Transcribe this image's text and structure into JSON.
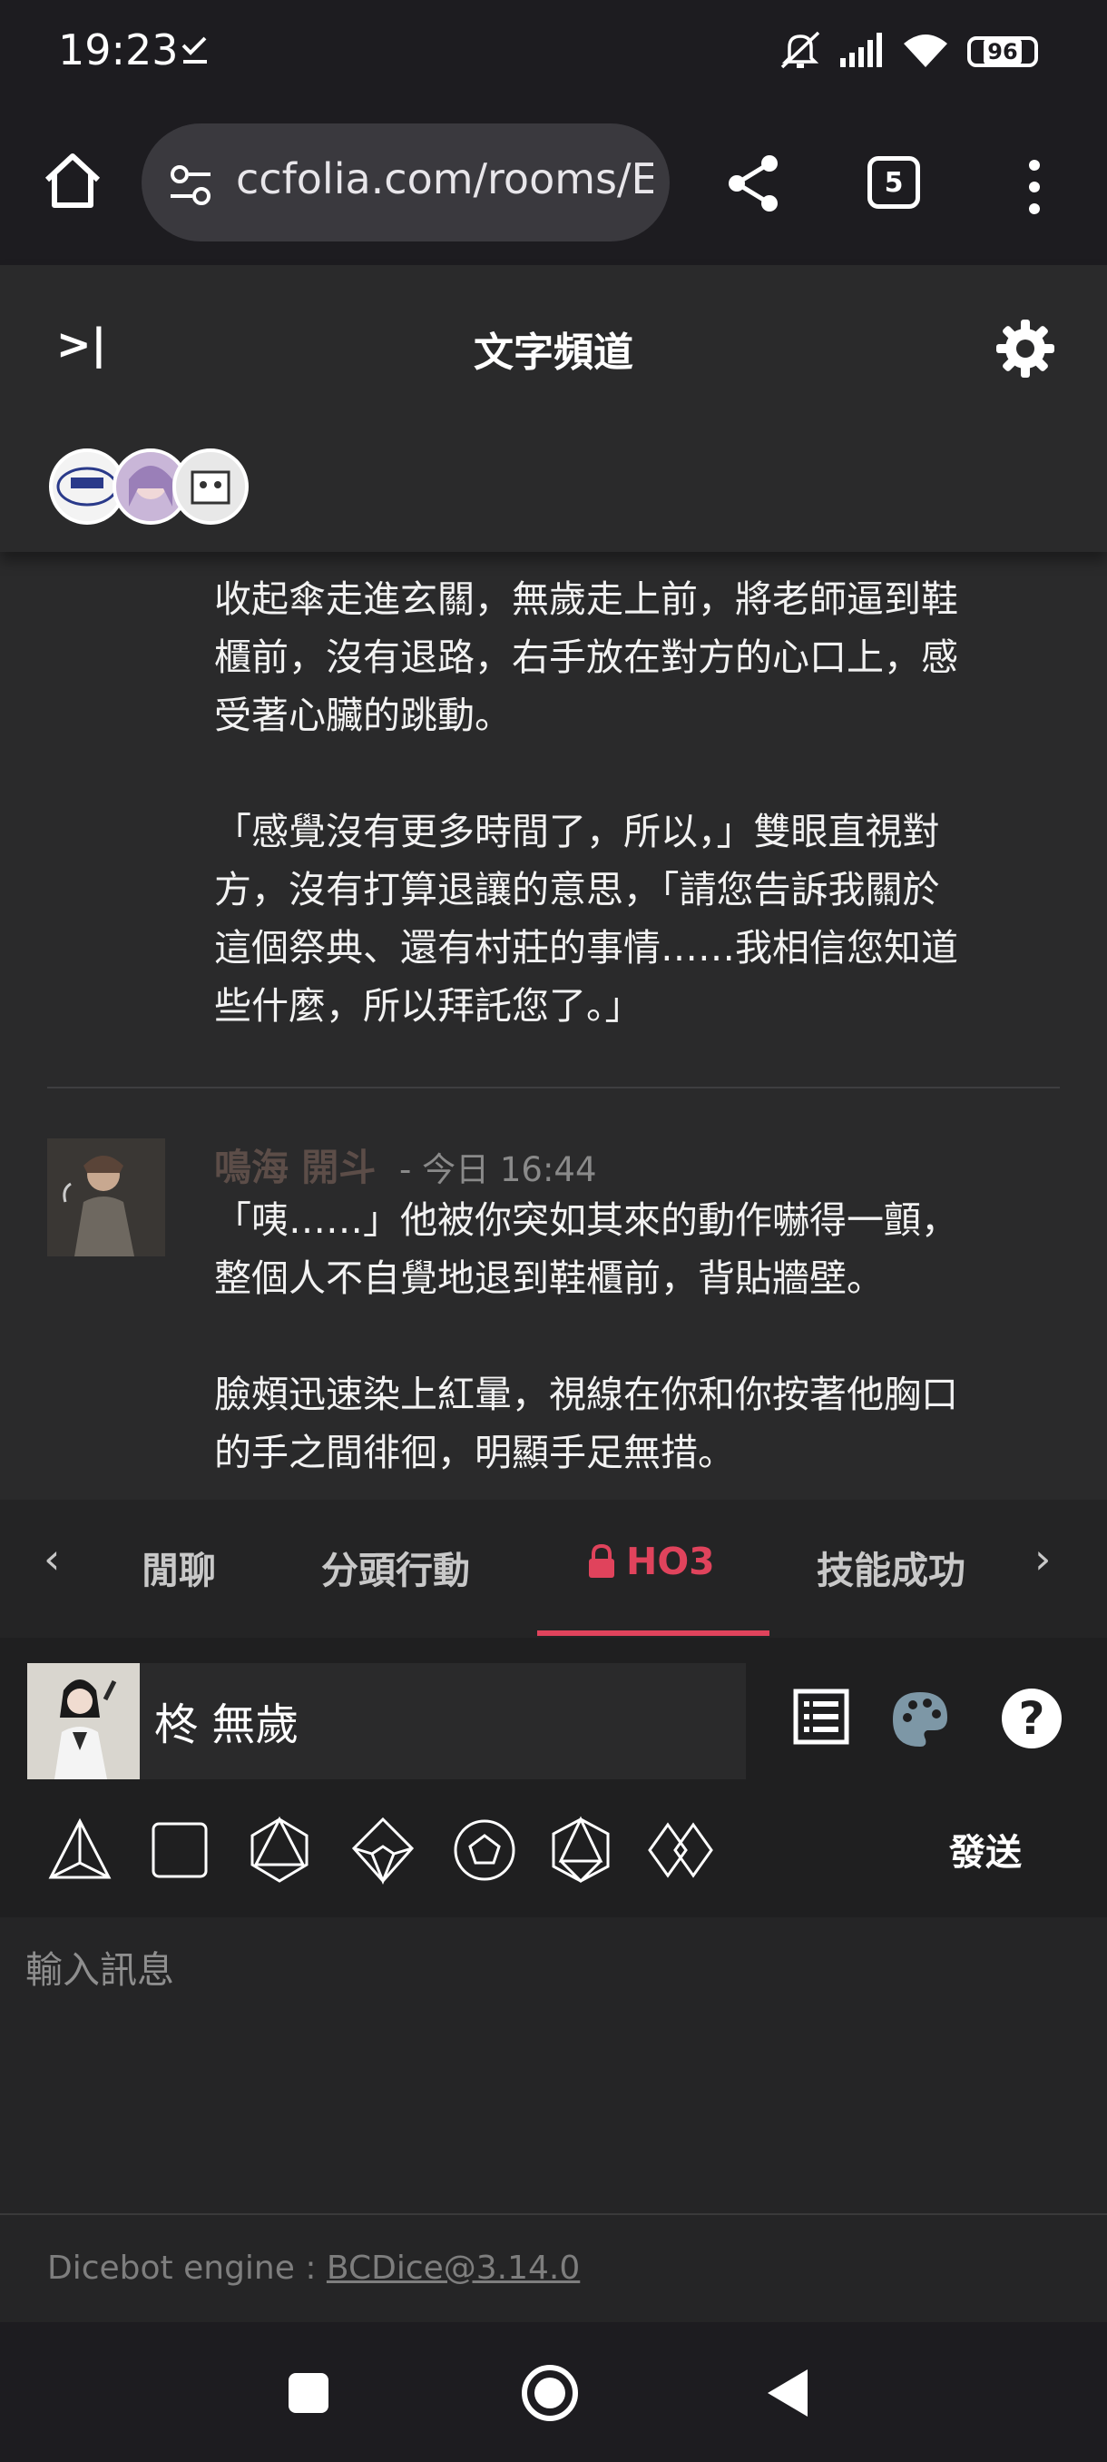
{
  "status_bar": {
    "time": "19:23",
    "battery": "96"
  },
  "browser": {
    "url": "ccfolia.com/rooms/Er",
    "tab_count": "5"
  },
  "channel": {
    "title": "文字頻道"
  },
  "messages": [
    {
      "text": "收起傘走進玄關，無歲走上前，將老師逼到鞋\n櫃前，沒有退路，右手放在對方的心口上，感\n受著心臟的跳動。\n\n「感覺沒有更多時間了，所以，」雙眼直視對\n方，沒有打算退讓的意思，「請您告訴我關於\n這個祭典、還有村莊的事情……我相信您知道\n些什麼，所以拜託您了。」"
    },
    {
      "name": "鳴海 開斗",
      "time": "- 今日 16:44",
      "text": "「咦……」他被你突如其來的動作嚇得一顫，\n整個人不自覺地退到鞋櫃前，背貼牆壁。\n\n臉頰迅速染上紅暈，視線在你和你按著他胸口\n的手之間徘徊，明顯手足無措。"
    }
  ],
  "tabs": [
    "閒聊",
    "分頭行動",
    "HO3",
    "技能成功"
  ],
  "input": {
    "character_name": "柊 無歲",
    "send_label": "發送",
    "placeholder": "輸入訊息"
  },
  "footer": {
    "prefix": "Dicebot engine : ",
    "link": "BCDice@3.14.0"
  },
  "colors": {
    "accent": "#e0435c",
    "background": "#2a2a2b"
  }
}
